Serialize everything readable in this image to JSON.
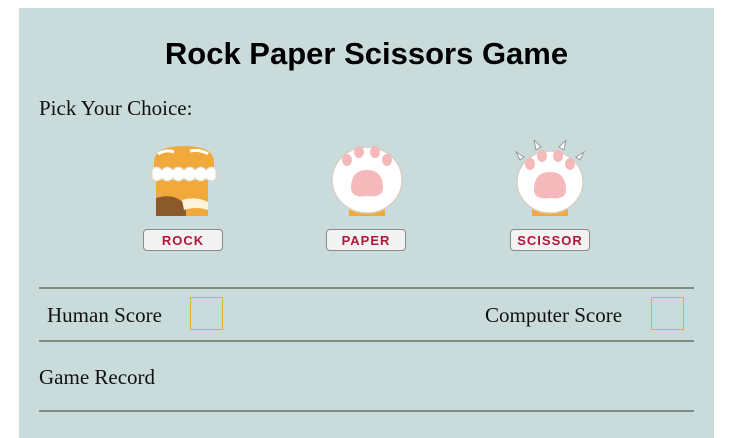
{
  "game": {
    "title": "Rock Paper Scissors Game",
    "pick_label": "Pick Your Choice:",
    "choices": [
      {
        "label": "ROCK",
        "icon": "orange-cat-paw-closed-icon"
      },
      {
        "label": "PAPER",
        "icon": "white-cat-paw-open-icon"
      },
      {
        "label": "SCISSOR",
        "icon": "white-cat-paw-claws-icon"
      }
    ],
    "human_score_label": "Human Score",
    "human_score": "",
    "computer_score_label": "Computer Score",
    "computer_score": "",
    "record_label": "Game Record"
  },
  "colors": {
    "panel_bg": "#cadbdb",
    "button_text": "#b0183a",
    "score_box_border": "#d9b13c",
    "divider": "#7f8c80",
    "paw_orange": "#f2a93b",
    "paw_pad_pink": "#f5b8bb"
  }
}
